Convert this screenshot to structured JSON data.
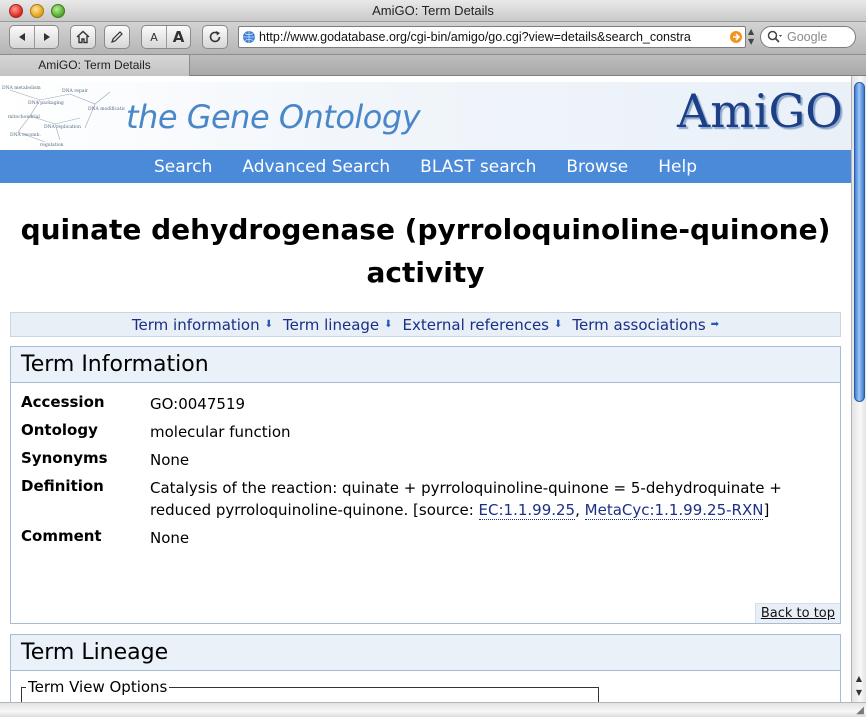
{
  "window": {
    "title": "AmiGO: Term Details"
  },
  "toolbar": {
    "url": "http://www.godatabase.org/cgi-bin/amigo/go.cgi?view=details&search_constra",
    "search_placeholder": "Google",
    "text_smaller": "A",
    "text_larger": "A"
  },
  "tabs": [
    {
      "label": "AmiGO: Term Details"
    }
  ],
  "banner": {
    "tagline": "the Gene Ontology",
    "logo": "AmiGO"
  },
  "mainnav": [
    {
      "label": "Search"
    },
    {
      "label": "Advanced Search"
    },
    {
      "label": "BLAST search"
    },
    {
      "label": "Browse"
    },
    {
      "label": "Help"
    }
  ],
  "term": {
    "title_line1": "quinate dehydrogenase (pyrroloquinoline-quinone)",
    "title_line2": "activity"
  },
  "jumpnav": [
    {
      "label": "Term information",
      "arrow": "⬇"
    },
    {
      "label": "Term lineage",
      "arrow": "⬇"
    },
    {
      "label": "External references",
      "arrow": "⬇"
    },
    {
      "label": "Term associations",
      "arrow": "➡"
    }
  ],
  "term_info": {
    "heading": "Term Information",
    "rows": {
      "accession": {
        "key": "Accession",
        "value": "GO:0047519"
      },
      "ontology": {
        "key": "Ontology",
        "value": "molecular function"
      },
      "synonyms": {
        "key": "Synonyms",
        "value": "None"
      },
      "definition": {
        "key": "Definition",
        "text": "Catalysis of the reaction: quinate + pyrroloquinoline-quinone = 5-dehydroquinate + reduced pyrroloquinoline-quinone. [source: ",
        "link1": "EC:1.1.99.25",
        "sep": ", ",
        "link2": "MetaCyc:1.1.99.25-RXN",
        "close": "]"
      },
      "comment": {
        "key": "Comment",
        "value": "None"
      }
    },
    "back_to_top": "Back to top"
  },
  "term_lineage": {
    "heading": "Term Lineage",
    "view_options_legend": "Term View Options"
  },
  "colors": {
    "nav_blue": "#4a8ad8",
    "link_navy": "#1a2f86",
    "panel_border": "#a6bbd6",
    "panel_head_bg": "#eaf1f9"
  }
}
